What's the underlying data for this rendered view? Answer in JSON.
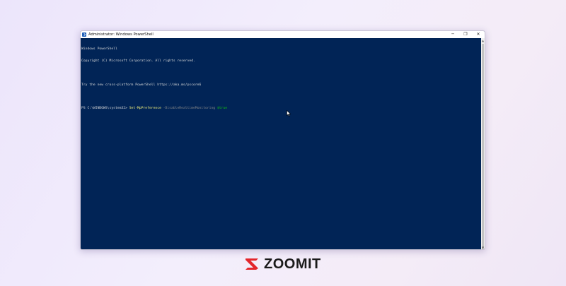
{
  "window": {
    "title": "Administrator: Windows PowerShell",
    "controls": {
      "minimize": "─",
      "maximize": "❐",
      "close": "✕"
    }
  },
  "console": {
    "lines": [
      "Windows PowerShell",
      "Copyright (C) Microsoft Corporation. All rights reserved.",
      "",
      "Try the new cross-platform PowerShell https://aka.ms/pscore6",
      ""
    ],
    "prompt": "PS C:\\WINDOWS\\system32> ",
    "command": {
      "cmdlet": "Set-MpPreference",
      "parameter": "-DisableRealtimeMonitoring",
      "value": "$true"
    }
  },
  "scrollbar": {
    "up": "▲",
    "down": "▼"
  },
  "brand": {
    "name": "ZOOMIT",
    "accent": "#e3262c"
  },
  "colors": {
    "console_bg": "#012456",
    "cmdlet": "#f4f27c",
    "parameter": "#8a8a8a",
    "value": "#13c80f"
  }
}
